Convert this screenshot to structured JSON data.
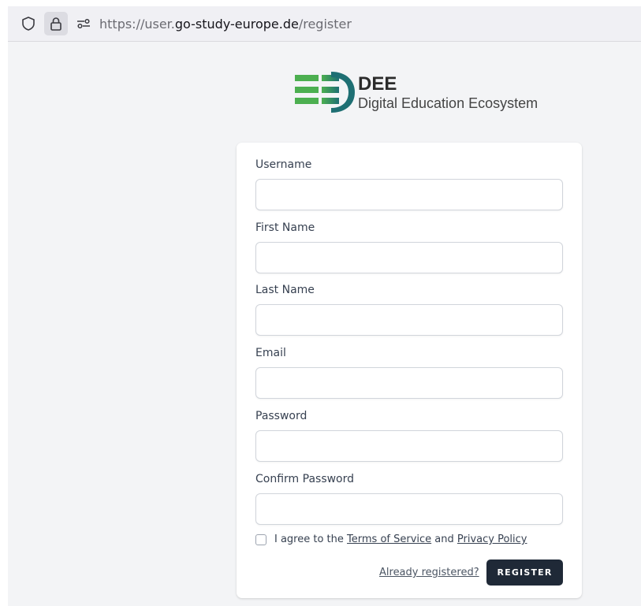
{
  "browser": {
    "url_prefix": "https://user.",
    "url_domain": "go-study-europe.de",
    "url_path": "/register",
    "icons": [
      "shield-icon",
      "lock-icon",
      "permissions-icon"
    ]
  },
  "logo": {
    "title": "DEE",
    "subtitle": "Digital Education Ecosystem",
    "colors": {
      "green": "#4caf50",
      "teal": "#1e6f73"
    }
  },
  "form": {
    "fields": [
      {
        "label": "Username",
        "value": ""
      },
      {
        "label": "First Name",
        "value": ""
      },
      {
        "label": "Last Name",
        "value": ""
      },
      {
        "label": "Email",
        "value": ""
      },
      {
        "label": "Password",
        "value": ""
      },
      {
        "label": "Confirm Password",
        "value": ""
      }
    ],
    "terms_prefix": "I agree to the ",
    "terms_link": "Terms of Service",
    "terms_and": " and ",
    "privacy_link": "Privacy Policy",
    "already_registered": "Already registered?",
    "register_label": "REGISTER"
  },
  "colors": {
    "page_bg": "#f3f4f6",
    "button_bg": "#1f2937"
  }
}
